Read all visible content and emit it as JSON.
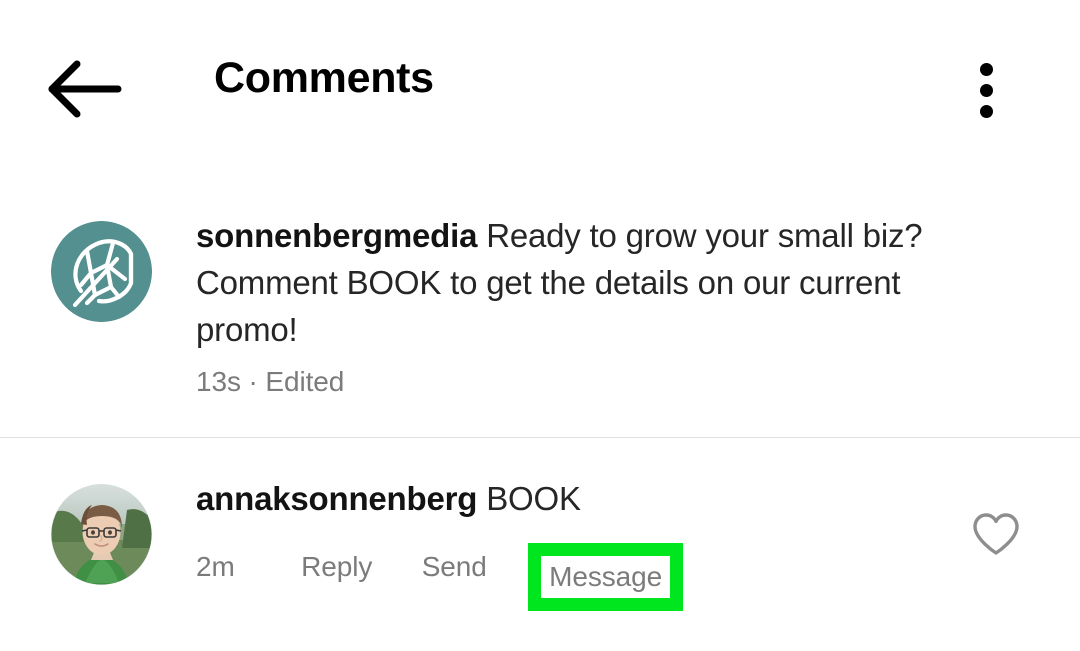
{
  "header": {
    "title": "Comments",
    "back_icon": "arrow-left-icon",
    "menu_icon": "kebab-menu-icon"
  },
  "comments": [
    {
      "username": "sonnenbergmedia",
      "text": "Ready to grow your small biz? Comment BOOK to get the details on our current promo!",
      "meta": "13s · Edited",
      "avatar_type": "logo",
      "avatar_name": "avatar-sonnenbergmedia",
      "avatar_color": "#53908f",
      "has_like": false,
      "actions": []
    },
    {
      "username": "annaksonnenberg",
      "text": "BOOK",
      "avatar_type": "photo",
      "avatar_name": "avatar-annaksonnenberg",
      "has_like": true,
      "like_icon": "heart-outline-icon",
      "actions": [
        {
          "label": "2m",
          "name": "comment-timestamp",
          "kind": "time"
        },
        {
          "label": "Reply",
          "name": "reply-button",
          "kind": "link"
        },
        {
          "label": "Send",
          "name": "send-button",
          "kind": "link"
        },
        {
          "label": "Message",
          "name": "message-button",
          "kind": "highlighted"
        }
      ]
    }
  ],
  "highlight": {
    "color": "#00e61e",
    "target": "Message"
  },
  "colors": {
    "background": "#ffffff",
    "primary_text": "#262626",
    "secondary_text": "#7b7b7b",
    "divider": "#dfdfdf",
    "avatar_teal": "#53908f",
    "highlight_green": "#00e61e"
  }
}
